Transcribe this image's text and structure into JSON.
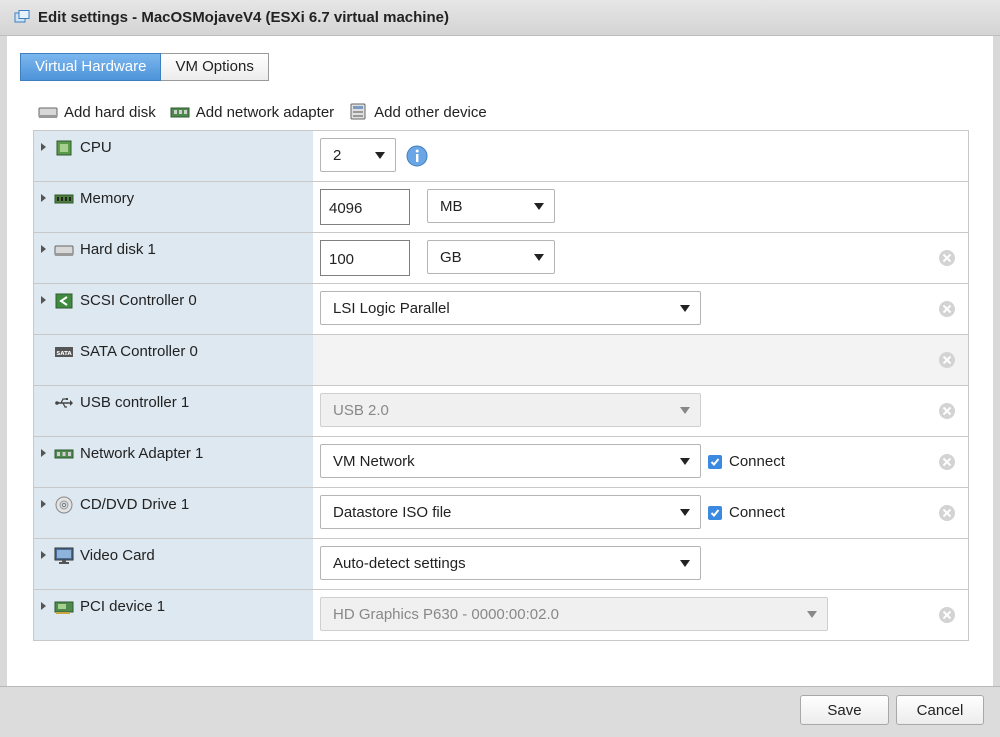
{
  "window": {
    "title": "Edit settings - MacOSMojaveV4 (ESXi 6.7 virtual machine)"
  },
  "tabs": [
    {
      "label": "Virtual Hardware",
      "active": true
    },
    {
      "label": "VM Options",
      "active": false
    }
  ],
  "toolbar": {
    "add_hard_disk": "Add hard disk",
    "add_network_adapter": "Add network adapter",
    "add_other_device": "Add other device"
  },
  "devices": {
    "cpu": {
      "label": "CPU",
      "value": "2",
      "icon": "cpu-icon"
    },
    "memory": {
      "label": "Memory",
      "value": "4096",
      "unit": "MB",
      "icon": "memory-icon"
    },
    "hard_disk": {
      "label": "Hard disk 1",
      "value": "100",
      "unit": "GB",
      "icon": "hard-disk-icon"
    },
    "scsi": {
      "label": "SCSI Controller 0",
      "value": "LSI Logic Parallel",
      "icon": "scsi-icon"
    },
    "sata": {
      "label": "SATA Controller 0",
      "icon": "sata-icon"
    },
    "usb": {
      "label": "USB controller 1",
      "value": "USB 2.0",
      "icon": "usb-icon"
    },
    "network": {
      "label": "Network Adapter 1",
      "value": "VM Network",
      "connect": "Connect",
      "connected": true,
      "icon": "network-adapter-icon"
    },
    "cdrom": {
      "label": "CD/DVD Drive 1",
      "value": "Datastore ISO file",
      "connect": "Connect",
      "connected": true,
      "icon": "cd-dvd-icon"
    },
    "video": {
      "label": "Video Card",
      "value": "Auto-detect settings",
      "icon": "monitor-icon"
    },
    "pci": {
      "label": "PCI device 1",
      "value": "HD Graphics P630 - 0000:00:02.0",
      "icon": "pci-card-icon"
    }
  },
  "footer": {
    "save": "Save",
    "cancel": "Cancel"
  },
  "colors": {
    "accent": "#4d93d9",
    "label_bg": "#dde8f1",
    "checkbox": "#3c8ae0",
    "footer_bg": "#dcdcdc"
  }
}
